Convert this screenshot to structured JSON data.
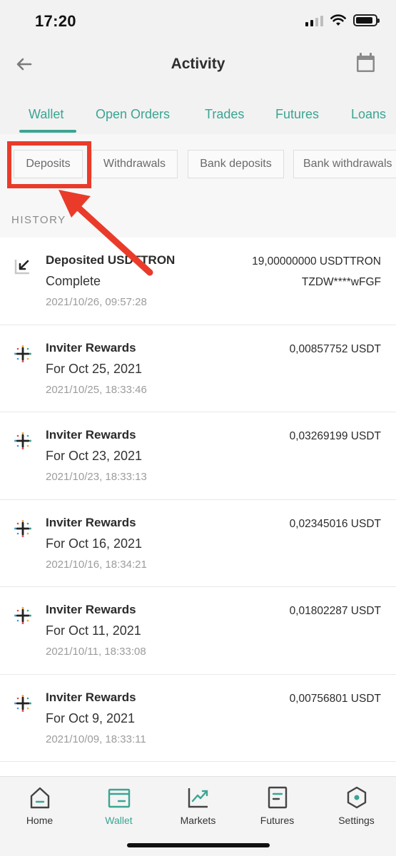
{
  "status_bar": {
    "time": "17:20"
  },
  "header": {
    "title": "Activity"
  },
  "tabs": [
    {
      "label": "Wallet",
      "active": true
    },
    {
      "label": "Open Orders",
      "active": false
    },
    {
      "label": "Trades",
      "active": false
    },
    {
      "label": "Futures",
      "active": false
    },
    {
      "label": "Loans",
      "active": false
    }
  ],
  "filters": [
    "Deposits",
    "Withdrawals",
    "Bank deposits",
    "Bank withdrawals"
  ],
  "history": {
    "label": "HISTORY",
    "rows": [
      {
        "icon": "deposit-arrow-icon",
        "title": "Deposited USDTTRON",
        "subtitle": "Complete",
        "time": "2021/10/26, 09:57:28",
        "amount": "19,00000000 USDTTRON",
        "address": "TZDW****wFGF"
      },
      {
        "icon": "rewards-plus-icon",
        "title": "Inviter Rewards",
        "subtitle": "For Oct 25, 2021",
        "time": "2021/10/25, 18:33:46",
        "amount": "0,00857752 USDT"
      },
      {
        "icon": "rewards-plus-icon",
        "title": "Inviter Rewards",
        "subtitle": "For Oct 23, 2021",
        "time": "2021/10/23, 18:33:13",
        "amount": "0,03269199 USDT"
      },
      {
        "icon": "rewards-plus-icon",
        "title": "Inviter Rewards",
        "subtitle": "For Oct 16, 2021",
        "time": "2021/10/16, 18:34:21",
        "amount": "0,02345016 USDT"
      },
      {
        "icon": "rewards-plus-icon",
        "title": "Inviter Rewards",
        "subtitle": "For Oct 11, 2021",
        "time": "2021/10/11, 18:33:08",
        "amount": "0,01802287 USDT"
      },
      {
        "icon": "rewards-plus-icon",
        "title": "Inviter Rewards",
        "subtitle": "For Oct 9, 2021",
        "time": "2021/10/09, 18:33:11",
        "amount": "0,00756801 USDT"
      }
    ]
  },
  "bottom_nav": [
    {
      "label": "Home",
      "icon": "home-icon",
      "active": false
    },
    {
      "label": "Wallet",
      "icon": "wallet-icon",
      "active": true
    },
    {
      "label": "Markets",
      "icon": "markets-icon",
      "active": false
    },
    {
      "label": "Futures",
      "icon": "futures-icon",
      "active": false
    },
    {
      "label": "Settings",
      "icon": "settings-icon",
      "active": false
    }
  ],
  "colors": {
    "accent": "#3aa592",
    "annotation": "#ea3b2a"
  }
}
